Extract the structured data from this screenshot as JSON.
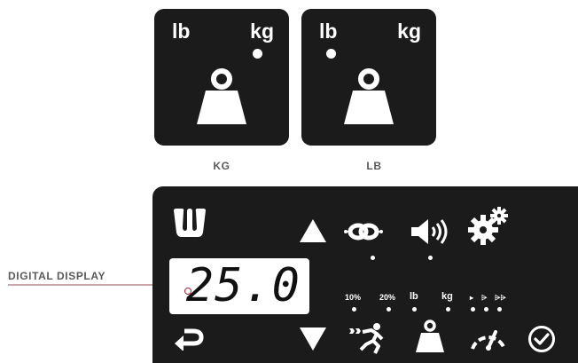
{
  "tiles": [
    {
      "unit_lb": "lb",
      "unit_kg": "kg",
      "caption": "KG",
      "selected": "kg"
    },
    {
      "unit_lb": "lb",
      "unit_kg": "kg",
      "caption": "LB",
      "selected": "lb"
    }
  ],
  "callout": {
    "label": "DIGITAL DISPLAY"
  },
  "display": {
    "value": "25.0"
  },
  "panel": {
    "brand_icon": "wilson-w-logo",
    "buttons": [
      "up-arrow",
      "down-arrow",
      "return",
      "check",
      "connect",
      "sound",
      "settings",
      "speed-runner",
      "weight",
      "gauge"
    ],
    "indicators": {
      "pct10": "10%",
      "pct20": "20%",
      "lb": "lb",
      "kg": "kg",
      "speed1": "▸",
      "speed2": "⩥",
      "speed3": "⩥⩥"
    }
  },
  "colors": {
    "panel": "#1b1b1b",
    "callout_accent": "#b5202e",
    "caption": "#5a5a5a"
  }
}
